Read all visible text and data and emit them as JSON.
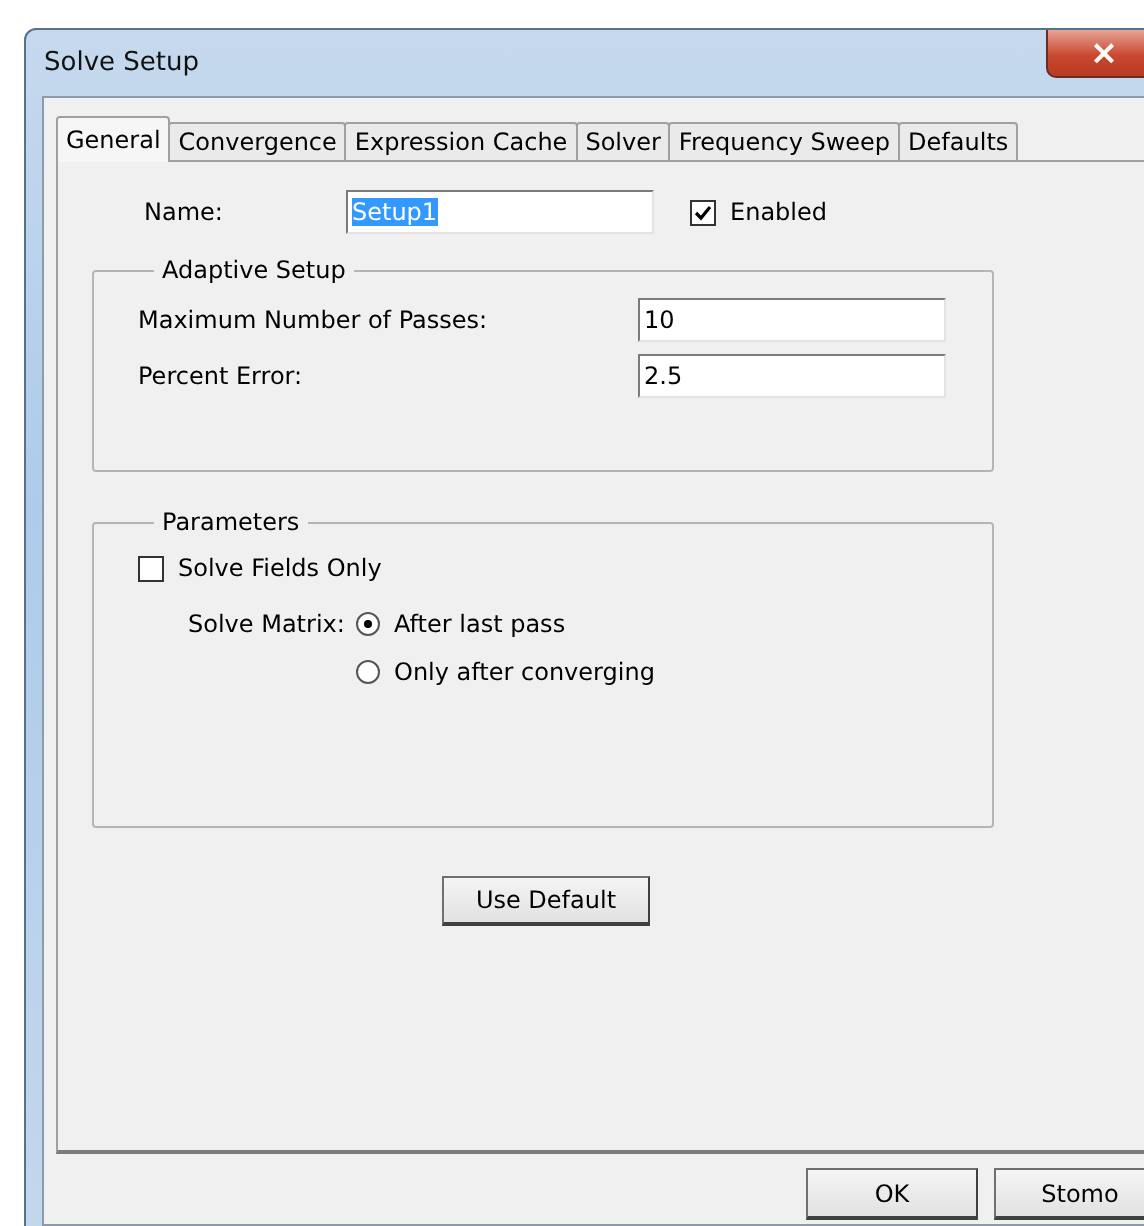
{
  "window": {
    "title": "Solve Setup",
    "close": "×"
  },
  "tabs": [
    {
      "label": "General",
      "selected": true
    },
    {
      "label": "Convergence",
      "selected": false
    },
    {
      "label": "Expression Cache",
      "selected": false
    },
    {
      "label": "Solver",
      "selected": false
    },
    {
      "label": "Frequency Sweep",
      "selected": false
    },
    {
      "label": "Defaults",
      "selected": false
    }
  ],
  "name": {
    "label": "Name:",
    "value": "Setup1",
    "text_selected": true
  },
  "enabled": {
    "label": "Enabled",
    "checked": true
  },
  "adaptive_setup": {
    "title": "Adaptive Setup",
    "fields": [
      {
        "label": "Maximum Number of Passes:",
        "value": "10"
      },
      {
        "label": "Percent Error:",
        "value": "2.5"
      }
    ]
  },
  "parameters": {
    "title": "Parameters",
    "solve_fields_only": {
      "label": "Solve Fields Only",
      "checked": false
    },
    "solve_matrix": {
      "label": "Solve Matrix:",
      "options": [
        {
          "label": "After last pass",
          "selected": true
        },
        {
          "label": "Only after converging",
          "selected": false
        }
      ]
    }
  },
  "use_default": "Use Default",
  "buttons": [
    "OK",
    "Stomo"
  ]
}
